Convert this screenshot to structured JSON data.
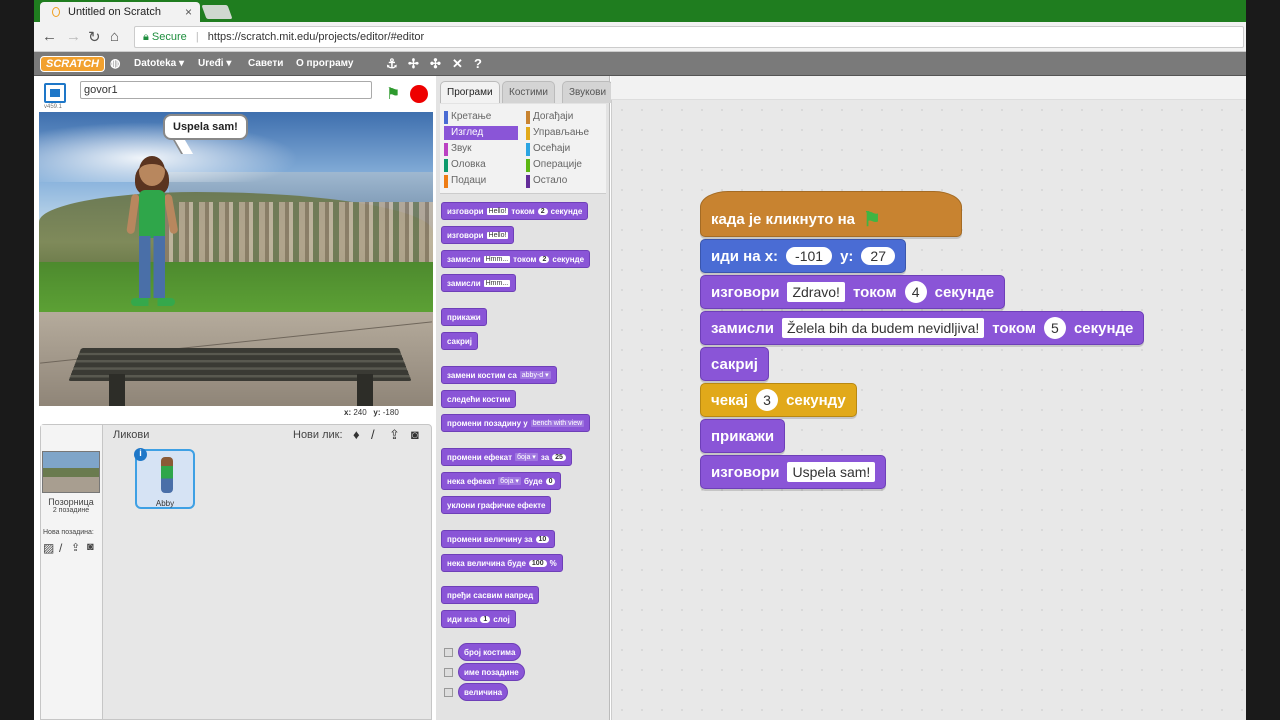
{
  "browser": {
    "tab_title": "Untitled on Scratch",
    "tab_close": "×",
    "secure_label": "Secure",
    "url": "https://scratch.mit.edu/projects/editor/#editor"
  },
  "menubar": {
    "logo": "SCRATCH",
    "file": "Datoteka ▾",
    "edit": "Uređi ▾",
    "tips": "Савети",
    "about": "О програму"
  },
  "stage": {
    "project_name": "govor1",
    "version": "v459.1",
    "bubble_text": "Uspela sam!",
    "coords_x_label": "x:",
    "coords_x": "240",
    "coords_y_label": "y:",
    "coords_y": "-180"
  },
  "sprites_panel": {
    "title": "Ликови",
    "new_sprite": "Нови лик:",
    "stage_label": "Позорница",
    "backdrops_count": "2 позадине",
    "new_backdrop": "Нова позадина:",
    "sprite_name": "Abby"
  },
  "palette": {
    "tabs": [
      "Програми",
      "Костими",
      "Звукови"
    ],
    "categories": [
      {
        "label": "Кретање",
        "color": "#4a6cd4"
      },
      {
        "label": "Изглед",
        "color": "#8a55d7"
      },
      {
        "label": "Звук",
        "color": "#bb42c3"
      },
      {
        "label": "Оловка",
        "color": "#0e9a6c"
      },
      {
        "label": "Подаци",
        "color": "#ee7d16"
      },
      {
        "label": "Догађаји",
        "color": "#c88330"
      },
      {
        "label": "Управљање",
        "color": "#e1a91a"
      },
      {
        "label": "Осећаји",
        "color": "#2ca5e2"
      },
      {
        "label": "Операције",
        "color": "#5cb712"
      },
      {
        "label": "Остало",
        "color": "#632d99"
      }
    ],
    "blocks": {
      "say_for": "изговори",
      "say_for_val": "Hello!",
      "say_for_mid": "током",
      "say_for_num": "2",
      "say_for_end": "секунде",
      "say": "изговори",
      "say_val": "Hello!",
      "think_for": "замисли",
      "think_for_val": "Hmm...",
      "think_for_mid": "током",
      "think_for_num": "2",
      "think_for_end": "секунде",
      "think": "замисли",
      "think_val": "Hmm...",
      "show": "прикажи",
      "hide": "сакриј",
      "switch_costume": "замени костим са",
      "switch_costume_val": "abby-d ▾",
      "next_costume": "следећи костим",
      "switch_backdrop": "промени позадину у",
      "switch_backdrop_val": "bench with view",
      "change_effect": "промени ефекат",
      "change_effect_val": "боја ▾",
      "change_effect_mid": "за",
      "change_effect_num": "25",
      "set_effect": "нека ефекат",
      "set_effect_val": "боја ▾",
      "set_effect_mid": "буде",
      "set_effect_num": "0",
      "clear_effects": "уклони графичке ефекте",
      "change_size": "промени величину за",
      "change_size_num": "10",
      "set_size": "нека величина буде",
      "set_size_num": "100",
      "set_size_end": "%",
      "front": "пређи сасвим напред",
      "back": "иди иза",
      "back_num": "1",
      "back_end": "слој",
      "costume_num": "број костима",
      "backdrop_name": "име позадине",
      "size": "величина"
    }
  },
  "script": {
    "hat": "када је кликнуто на",
    "goto_label": "иди на x:",
    "goto_x": "-101",
    "goto_y_label": "y:",
    "goto_y": "27",
    "say1_label": "изговори",
    "say1_val": "Zdravo!",
    "say1_mid": "током",
    "say1_num": "4",
    "say1_end": "секунде",
    "think_label": "замисли",
    "think_val": "Želela bih da budem nevidljiva!",
    "think_mid": "током",
    "think_num": "5",
    "think_end": "секунде",
    "hide": "сакриј",
    "wait_label": "чекај",
    "wait_num": "3",
    "wait_end": "секунду",
    "show": "прикажи",
    "say2_label": "изговори",
    "say2_val": "Uspela sam!"
  }
}
